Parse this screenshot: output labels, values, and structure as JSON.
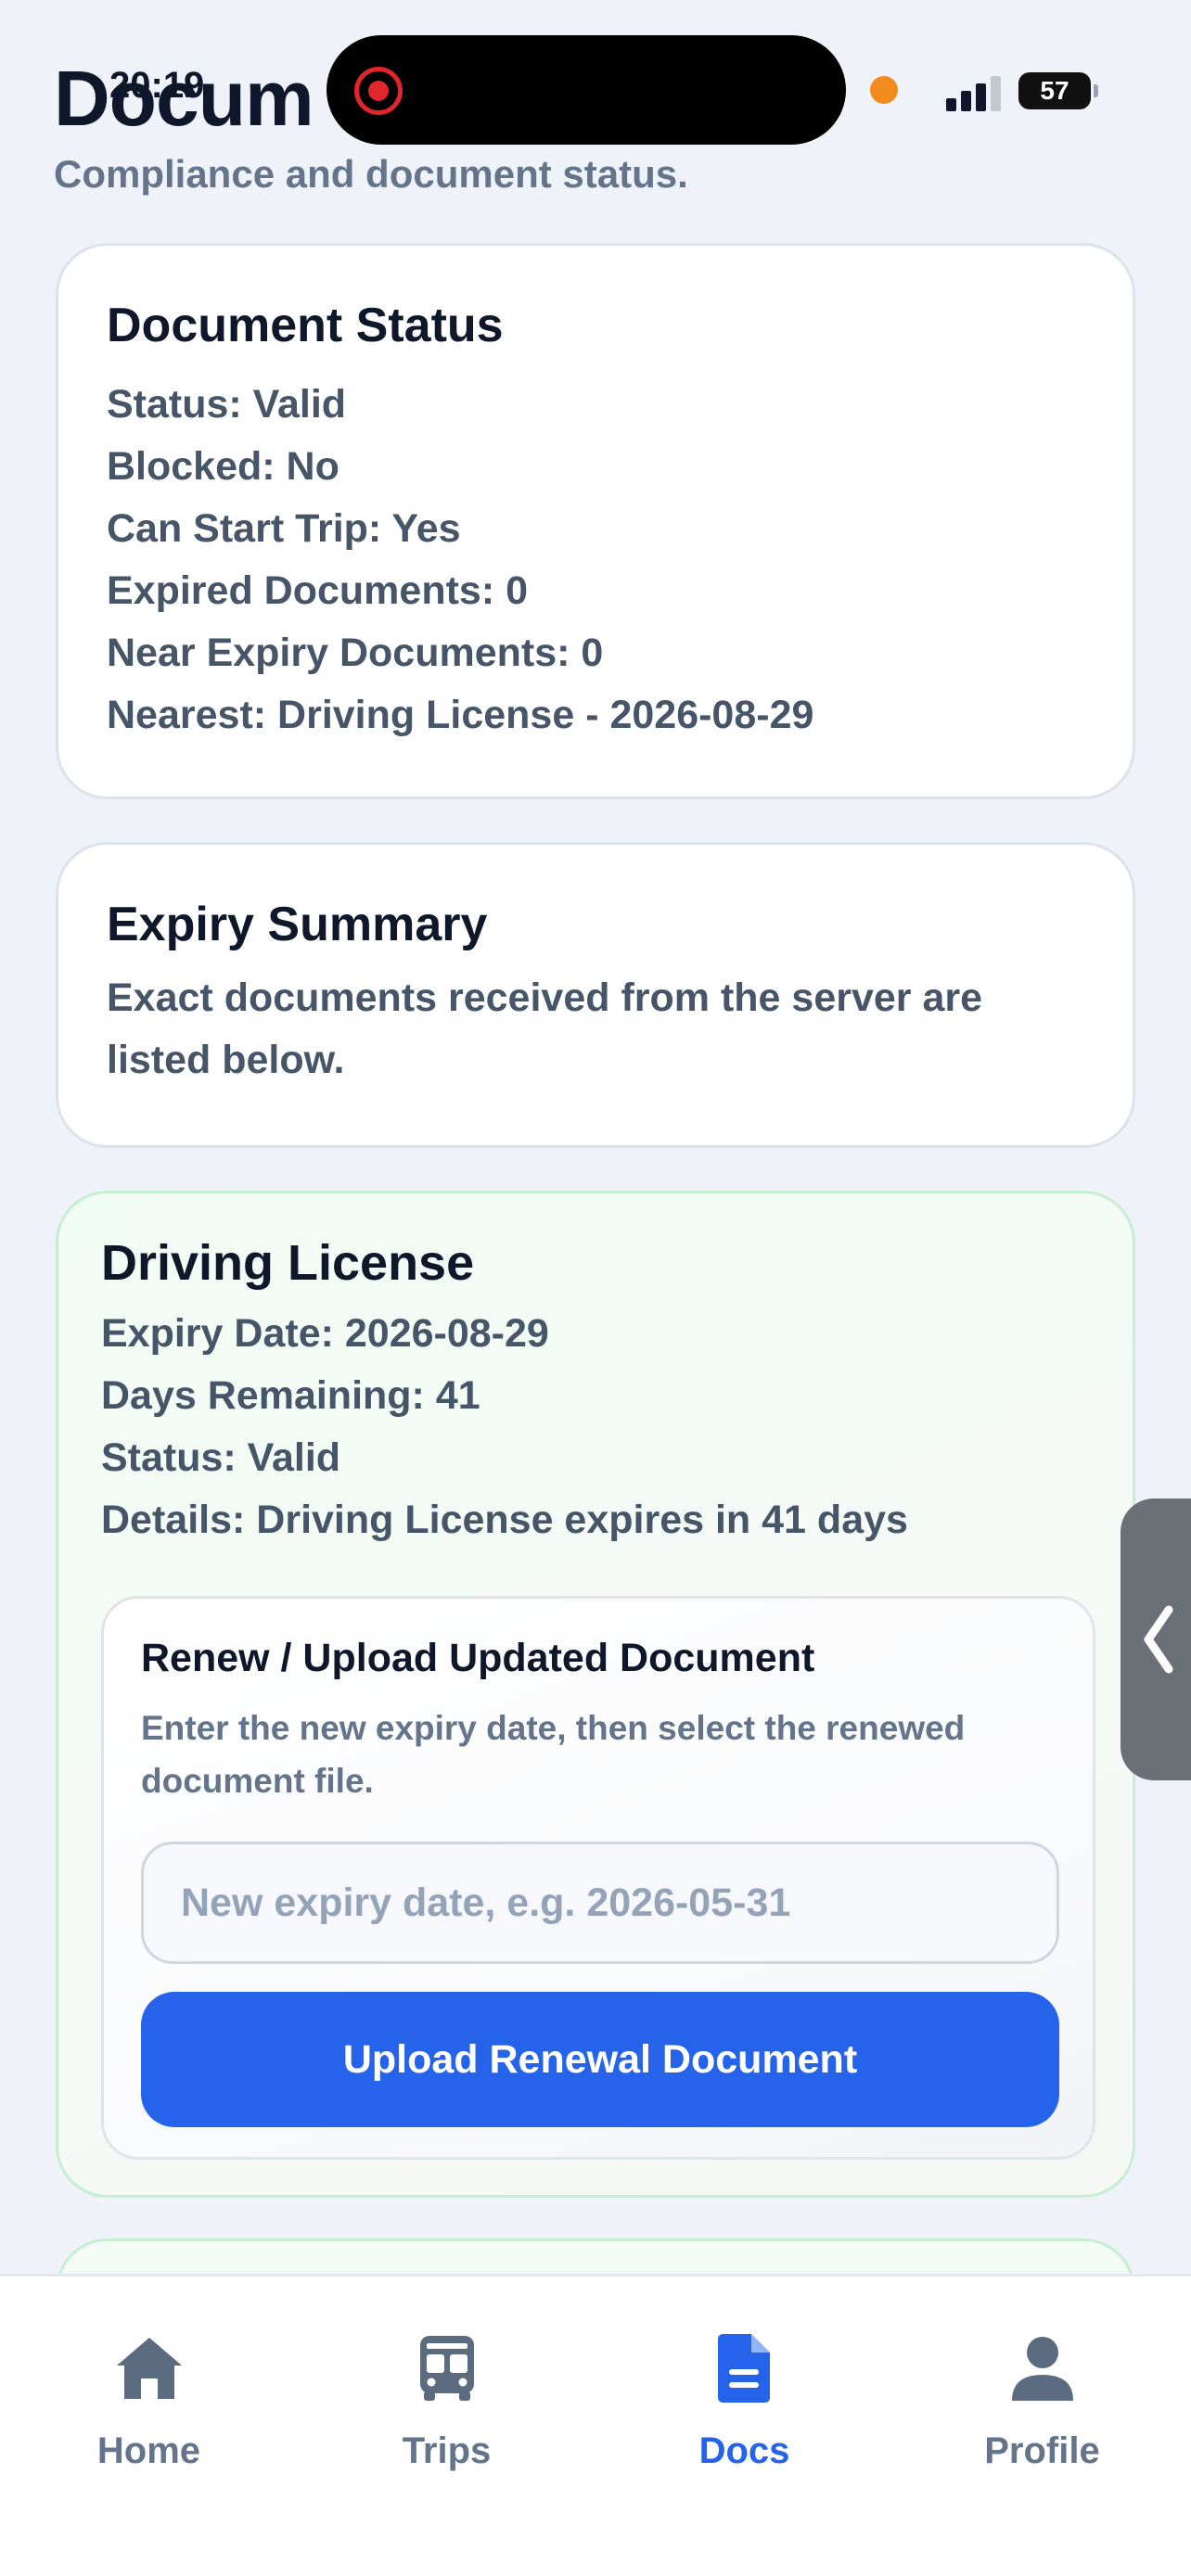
{
  "status_bar": {
    "time": "20:19",
    "battery": "57"
  },
  "header": {
    "title": "Docum",
    "subtitle": "Compliance and document status."
  },
  "document_status": {
    "title": "Document Status",
    "lines": [
      "Status: Valid",
      "Blocked: No",
      "Can Start Trip: Yes",
      "Expired Documents: 0",
      "Near Expiry Documents: 0",
      "Nearest: Driving License - 2026-08-29"
    ]
  },
  "expiry_summary": {
    "title": "Expiry Summary",
    "description": "Exact documents received from the server are listed below."
  },
  "driving_license": {
    "title": "Driving License",
    "lines": [
      "Expiry Date: 2026-08-29",
      "Days Remaining: 41",
      "Status: Valid",
      "Details: Driving License expires in 41 days"
    ],
    "renew": {
      "title": "Renew / Upload Updated Document",
      "description": "Enter the new expiry date, then select the renewed document file.",
      "input_placeholder": "New expiry date, e.g. 2026-05-31",
      "button_label": "Upload Renewal Document"
    }
  },
  "tabs": [
    {
      "label": "Home",
      "icon": "home-icon",
      "active": false
    },
    {
      "label": "Trips",
      "icon": "bus-icon",
      "active": false
    },
    {
      "label": "Docs",
      "icon": "document-icon",
      "active": true
    },
    {
      "label": "Profile",
      "icon": "user-icon",
      "active": false
    }
  ],
  "colors": {
    "accent": "#2563eb",
    "valid_border": "#c6efd1",
    "muted_text": "#64748b",
    "recording": "#e0252c"
  }
}
